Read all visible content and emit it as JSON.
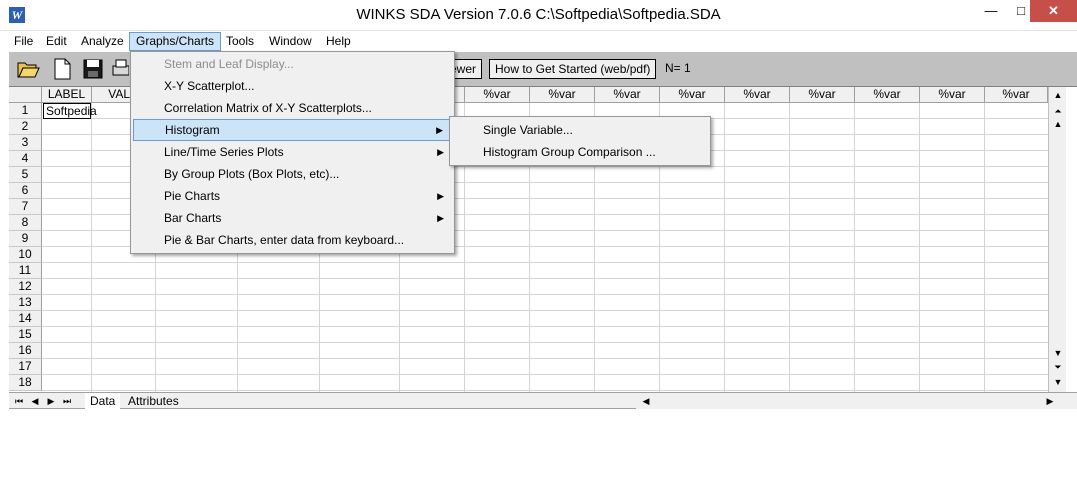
{
  "window": {
    "title": "WINKS SDA Version 7.0.6 C:\\Softpedia\\Softpedia.SDA",
    "minimize": "—",
    "maximize": "□",
    "close": "✕"
  },
  "menubar": {
    "items": [
      "File",
      "Edit",
      "Analyze",
      "Graphs/Charts",
      "Tools",
      "Window",
      "Help"
    ]
  },
  "toolbar": {
    "viewer_label": "ewer",
    "get_started_label": "How to Get Started (web/pdf)",
    "n_text": "N= 1"
  },
  "grid": {
    "columns": [
      "LABEL",
      "VALU",
      "",
      "",
      "",
      "%var",
      "%var",
      "%var",
      "%var",
      "%var",
      "%var",
      "%var",
      "%var",
      "%var"
    ],
    "rows": [
      "1",
      "2",
      "3",
      "4",
      "5",
      "6",
      "7",
      "8",
      "9",
      "10",
      "11",
      "12",
      "13",
      "14",
      "15",
      "16",
      "17",
      "18"
    ],
    "active_cell_value": "Softpedia"
  },
  "sheet_tabs": [
    "Data",
    "Attributes"
  ],
  "graphs_menu": {
    "items": [
      {
        "label": "Stem and Leaf Display...",
        "disabled": true,
        "submenu": false
      },
      {
        "label": "X-Y Scatterplot...",
        "disabled": false,
        "submenu": false
      },
      {
        "label": "Correlation Matrix of X-Y Scatterplots...",
        "disabled": false,
        "submenu": false
      },
      {
        "label": "Histogram",
        "disabled": false,
        "submenu": true
      },
      {
        "label": "Line/Time Series Plots",
        "disabled": false,
        "submenu": true
      },
      {
        "label": "By Group Plots (Box Plots, etc)...",
        "disabled": false,
        "submenu": false
      },
      {
        "label": "Pie Charts",
        "disabled": false,
        "submenu": true
      },
      {
        "label": "Bar Charts",
        "disabled": false,
        "submenu": true
      },
      {
        "label": "Pie & Bar Charts, enter data from keyboard...",
        "disabled": false,
        "submenu": false
      }
    ]
  },
  "histogram_submenu": {
    "items": [
      "Single Variable...",
      "Histogram Group Comparison ..."
    ]
  },
  "colors": {
    "highlight": "#cce4f7",
    "highlight_border": "#6f9ad0",
    "close_button": "#c74f4a",
    "toolbar": "#c0c0c0"
  }
}
